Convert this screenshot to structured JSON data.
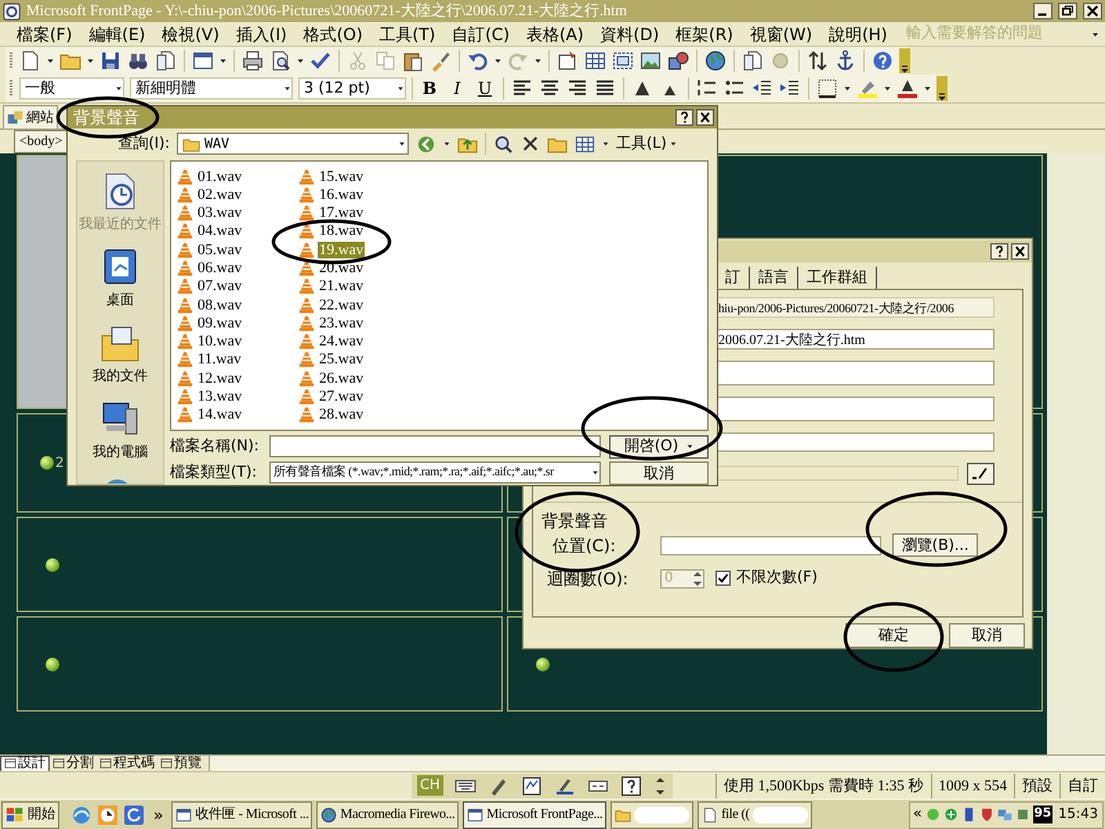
{
  "window": {
    "title": "Microsoft FrontPage - Y:\\-chiu-pon\\2006-Pictures\\20060721-大陸之行\\2006.07.21-大陸之行.htm"
  },
  "menu": [
    "檔案(F)",
    "編輯(E)",
    "檢視(V)",
    "插入(I)",
    "格式(O)",
    "工具(T)",
    "自訂(C)",
    "表格(A)",
    "資料(D)",
    "框架(R)",
    "視窗(W)",
    "說明(H)"
  ],
  "help_box": {
    "placeholder": "輸入需要解答的問題"
  },
  "formatting": {
    "style": "一般",
    "font": "新細明體",
    "size": "3  (12 pt)",
    "text_buttons": [
      "B",
      "I",
      "U"
    ]
  },
  "workspace": {
    "tab": "網站",
    "quick_tag": "<body>",
    "cell_text": "2"
  },
  "view_tabs": [
    {
      "label": "設計",
      "selected": true
    },
    {
      "label": "分割",
      "selected": false
    },
    {
      "label": "程式碼",
      "selected": false
    },
    {
      "label": "預覽",
      "selected": false
    }
  ],
  "status_bar": {
    "ime": "CH",
    "download": "使用 1,500Kbps 需費時 1:35 秒",
    "size": "1009 x 554",
    "mode_1": "預設",
    "mode_2": "自訂"
  },
  "taskbar": {
    "start": "開始",
    "chevron": "»",
    "tasks": [
      {
        "label": "收件匣 - Microsoft ...",
        "selected": false,
        "redacted": false
      },
      {
        "label": "Macromedia Firewo...",
        "selected": false,
        "redacted": false
      },
      {
        "label": "Microsoft FrontPage...",
        "selected": true,
        "redacted": false
      },
      {
        "selected": false,
        "redacted": true
      },
      {
        "label": "file ((",
        "selected": false,
        "redacted": true
      }
    ],
    "tray_chevron": "«",
    "tray_badge": "95",
    "clock": "15:43"
  },
  "file_dialog": {
    "title": "背景聲音",
    "look_in_label": "查詢(I):",
    "look_in": "WAV",
    "tools": "工具(L)",
    "places": [
      {
        "label": "我最近的文件",
        "disabled": true
      },
      {
        "label": "桌面",
        "disabled": false
      },
      {
        "label": "我的文件",
        "disabled": false
      },
      {
        "label": "我的電腦",
        "disabled": false
      }
    ],
    "files": [
      {
        "name": "01.wav",
        "selected": false
      },
      {
        "name": "02.wav",
        "selected": false
      },
      {
        "name": "03.wav",
        "selected": false
      },
      {
        "name": "04.wav",
        "selected": false
      },
      {
        "name": "05.wav",
        "selected": false
      },
      {
        "name": "06.wav",
        "selected": false
      },
      {
        "name": "07.wav",
        "selected": false
      },
      {
        "name": "08.wav",
        "selected": false
      },
      {
        "name": "09.wav",
        "selected": false
      },
      {
        "name": "10.wav",
        "selected": false
      },
      {
        "name": "11.wav",
        "selected": false
      },
      {
        "name": "12.wav",
        "selected": false
      },
      {
        "name": "13.wav",
        "selected": false
      },
      {
        "name": "14.wav",
        "selected": false
      },
      {
        "name": "15.wav",
        "selected": false
      },
      {
        "name": "16.wav",
        "selected": false
      },
      {
        "name": "17.wav",
        "selected": false
      },
      {
        "name": "18.wav",
        "selected": false
      },
      {
        "name": "19.wav",
        "selected": true
      },
      {
        "name": "20.wav",
        "selected": false
      },
      {
        "name": "21.wav",
        "selected": false
      },
      {
        "name": "22.wav",
        "selected": false
      },
      {
        "name": "23.wav",
        "selected": false
      },
      {
        "name": "24.wav",
        "selected": false
      },
      {
        "name": "25.wav",
        "selected": false
      },
      {
        "name": "26.wav",
        "selected": false
      },
      {
        "name": "27.wav",
        "selected": false
      },
      {
        "name": "28.wav",
        "selected": false
      }
    ],
    "file_name_label": "檔案名稱(N):",
    "file_type_label": "檔案類型(T):",
    "file_type": "所有聲音檔案 (*.wav;*.mid;*.ram;*.ra;*.aif;*.aifc;*.au;*.sr",
    "open": "開啓(O)",
    "cancel": "取消"
  },
  "page_properties": {
    "tabs": [
      {
        "label": "訂",
        "selected": false
      },
      {
        "label": "語言",
        "selected": false
      },
      {
        "label": "工作群組",
        "selected": false
      }
    ],
    "location_value": "hiu-pon/2006-Pictures/20060721-大陸之行/2006",
    "title_value": "2006.07.21-大陸之行.htm",
    "group_label": "背景聲音",
    "location_label": "位置(C):",
    "browse": "瀏覽(B)...",
    "loop_label": "迴圈數(O):",
    "loop_count": "0",
    "forever": {
      "label": "不限次數(F)",
      "checked": true
    },
    "ok": "確定",
    "cancel": "取消"
  }
}
